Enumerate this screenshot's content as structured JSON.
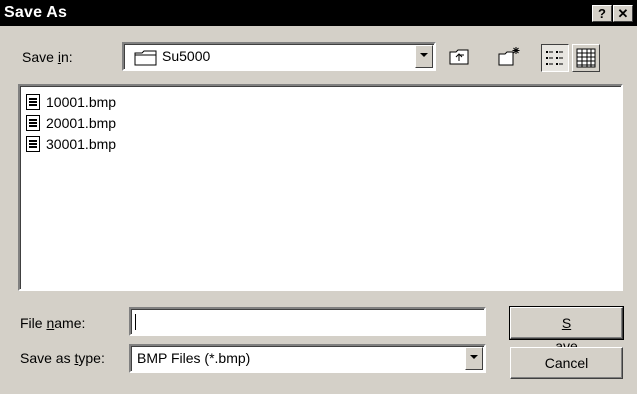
{
  "window": {
    "title": "Save As",
    "help_glyph": "?",
    "close_glyph": "✕"
  },
  "save_in": {
    "label_pre": "Save ",
    "label_key": "i",
    "label_post": "n:",
    "value": "Su5000"
  },
  "toolbar": {
    "icons": [
      "up-one-level-icon",
      "create-new-folder-icon",
      "list-view-icon",
      "details-view-icon"
    ]
  },
  "files": [
    {
      "name": "10001.bmp"
    },
    {
      "name": "20001.bmp"
    },
    {
      "name": "30001.bmp"
    }
  ],
  "file_name": {
    "label_pre": "File ",
    "label_key": "n",
    "label_post": "ame:",
    "value": ""
  },
  "save_type": {
    "label_pre": "Save as ",
    "label_key": "t",
    "label_post": "ype:",
    "value": "BMP Files (*.bmp)"
  },
  "buttons": {
    "save_key": "S",
    "save_rest": "ave",
    "cancel": "Cancel"
  }
}
